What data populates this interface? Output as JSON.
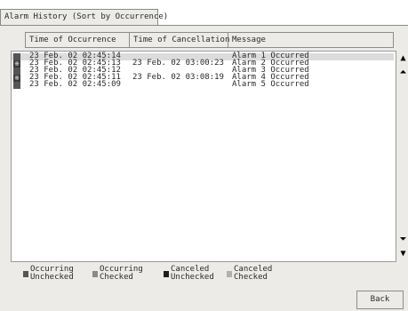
{
  "tab": {
    "title": "Alarm History (Sort by Occurrence)"
  },
  "columns": {
    "occurrence": "Time of Occurrence",
    "cancellation": "Time of Cancellation",
    "message": "Message"
  },
  "rows": [
    {
      "status": "Occurring Unchecked",
      "mark": "",
      "occurred": "23 Feb. 02 02:45:14",
      "cancelled": "",
      "message": "Alarm 1 Occurred"
    },
    {
      "status": "Canceled Unchecked",
      "mark": "※",
      "occurred": "23 Feb. 02 02:45:13",
      "cancelled": "23 Feb. 02 03:00:23",
      "message": "Alarm 2 Occurred"
    },
    {
      "status": "Occurring Unchecked",
      "mark": "",
      "occurred": "23 Feb. 02 02:45:12",
      "cancelled": "",
      "message": "Alarm 3 Occurred"
    },
    {
      "status": "Canceled Unchecked",
      "mark": "※",
      "occurred": "23 Feb. 02 02:45:11",
      "cancelled": "23 Feb. 02 03:08:19",
      "message": "Alarm 4 Occurred"
    },
    {
      "status": "Occurring Unchecked",
      "mark": "",
      "occurred": "23 Feb. 02 02:45:09",
      "cancelled": "",
      "message": "Alarm 5 Occurred"
    }
  ],
  "scrollbar": {
    "up": "▲",
    "page_up": "⏶",
    "page_down": "⏷",
    "down": "▼"
  },
  "legend": [
    {
      "line1": "Occurring",
      "line2": "Unchecked",
      "color": "#555555"
    },
    {
      "line1": "Occurring",
      "line2": "Checked",
      "color": "#8a8a8a"
    },
    {
      "line1": "Canceled",
      "line2": "Unchecked",
      "color": "#1e1e1e"
    },
    {
      "line1": "Canceled",
      "line2": "Checked",
      "color": "#b0b0b0"
    }
  ],
  "buttons": {
    "back": "Back"
  },
  "colors": {
    "panel": "#ecebe8",
    "occurring_unchecked": "#555555",
    "canceled_unchecked": "#3a3a3a"
  }
}
